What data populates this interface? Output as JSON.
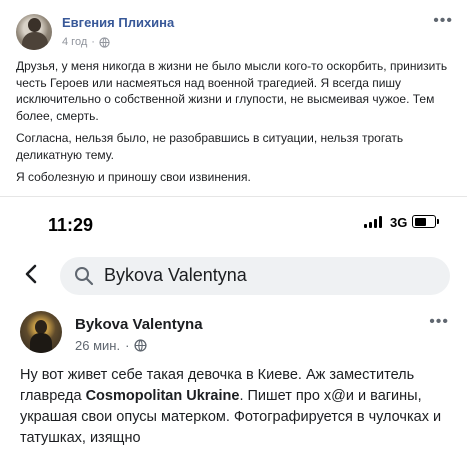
{
  "post": {
    "author": "Евгения Плихина",
    "time": "4 год",
    "more_icon": "more-dots-icon",
    "paragraphs": [
      "Друзья, у меня никогда в жизни не было мысли кого-то оскорбить, принизить честь Героев или насмеяться над военной трагедией. Я всегда пишу исключительно о собственной жизни и глупости, не высмеивая чужое. Тем более, смерть.",
      "Согласна, нельзя было, не разобравшись в ситуации, нельзя трогать деликатную тему.",
      "Я соболезную и приношу свои извинения."
    ]
  },
  "phone": {
    "status": {
      "time": "11:29",
      "network": "3G",
      "battery_level": 0.7
    },
    "search": {
      "query": "Bykova Valentyna"
    },
    "post": {
      "author": "Bykova Valentyna",
      "time": "26 мин.",
      "text_parts": [
        "Ну вот живет себе такая девочка в Киеве. Аж заместитель главреда ",
        "Cosmopolitan Ukraine",
        ". Пишет про х@и и вагины, украшая свои опусы матерком. Фотографируется в чулочках и татушках, изящно"
      ]
    }
  }
}
